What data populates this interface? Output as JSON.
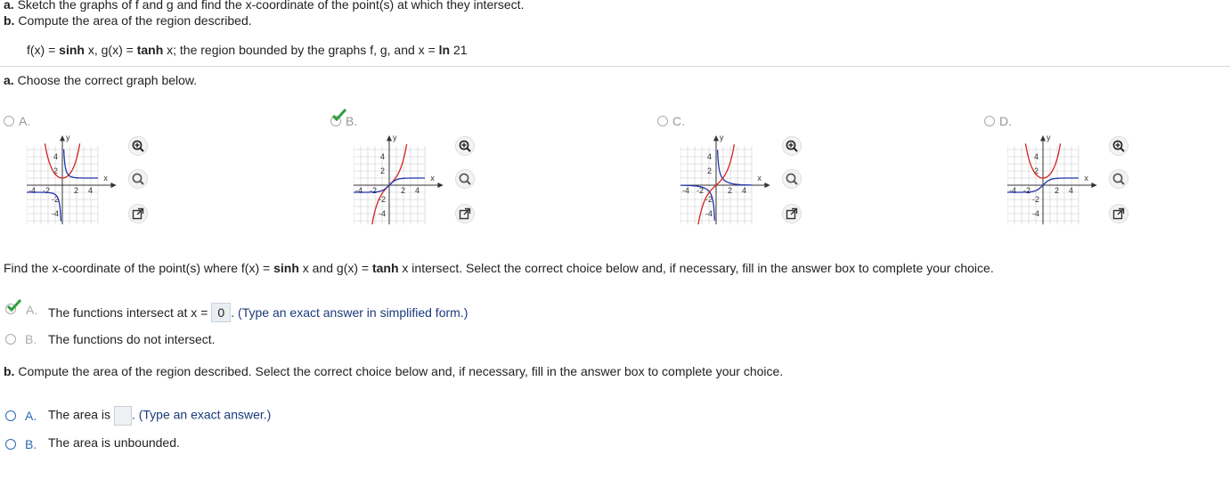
{
  "header": {
    "line_a_bold": "a.",
    "line_a_text": " Sketch the graphs of f and g and find the x-coordinate of the point(s) at which they intersect.",
    "line_b_bold": "b.",
    "line_b_text": " Compute the area of the region described."
  },
  "problem": {
    "prefix": "f(x) = ",
    "f_func": "sinh",
    "mid1": " x, g(x) = ",
    "g_func": "tanh",
    "mid2": " x; the region bounded by the graphs f, g, and x = ",
    "bound": "ln",
    "bound_val": " 21"
  },
  "part_a": {
    "bold": "a.",
    "text": " Choose the correct graph below.",
    "options": [
      {
        "letter": "A.",
        "selected": false
      },
      {
        "letter": "B.",
        "selected": true
      },
      {
        "letter": "C.",
        "selected": false
      },
      {
        "letter": "D.",
        "selected": false
      }
    ],
    "graph_labels": {
      "y": "y",
      "x": "x",
      "t4": "4",
      "t2": "2",
      "tm2": "-2",
      "tm4": "-4",
      "tm4b": "-4"
    }
  },
  "intersection": {
    "prompt_start": "Find the x-coordinate of the point(s) where f(x) = ",
    "f_func": "sinh",
    "mid1": " x and g(x) = ",
    "g_func": "tanh",
    "prompt_end": " x intersect. Select the correct choice below and, if necessary, fill in the answer box to complete your choice.",
    "option_a_letter": "A.",
    "option_a_text": "The functions intersect at x = ",
    "option_a_value": "0",
    "option_a_hint": ". (Type an exact answer in simplified form.)",
    "option_b_letter": "B.",
    "option_b_text": "The functions do not intersect."
  },
  "part_b": {
    "bold": "b.",
    "text": " Compute the area of the region described. Select the correct choice below and, if necessary, fill in the answer box to complete your choice.",
    "option_a_letter": "A.",
    "option_a_text": "The area is",
    "option_a_hint": ". (Type an exact answer.)",
    "option_b_letter": "B.",
    "option_b_text": "The area is unbounded."
  },
  "colors": {
    "accent_blue": "#2a6ab3",
    "check_green": "#2e9e3e",
    "curve_red": "#d4231f",
    "curve_blue": "#2233aa"
  },
  "icons": [
    "zoom-in-icon",
    "zoom-out-icon",
    "popout-icon",
    "checkmark-icon"
  ]
}
